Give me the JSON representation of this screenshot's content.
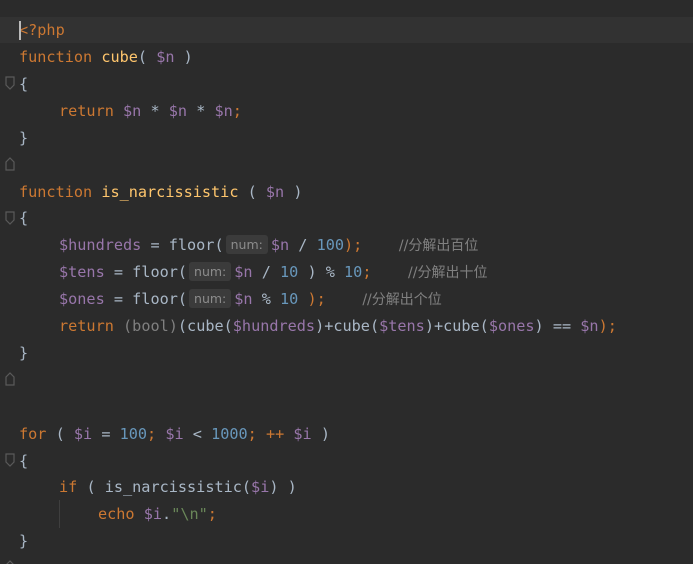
{
  "editor": {
    "theme_colors": {
      "background": "#2b2b2b",
      "keyword": "#cc7832",
      "function": "#ffc66d",
      "variable": "#9876aa",
      "number": "#6897bb",
      "string": "#6a8759",
      "comment": "#808080",
      "text": "#a9b7c6"
    },
    "hint_label": "num:",
    "lines": {
      "l1": {
        "php_open": "<?php"
      },
      "l2": {
        "kw": "function",
        "name": "cube",
        "open": "( ",
        "param": "$n",
        "close": " )"
      },
      "l3": {
        "brace": "{"
      },
      "l4": {
        "kw": "return",
        "v1": "$n",
        "op1": " * ",
        "v2": "$n",
        "op2": " * ",
        "v3": "$n",
        "end": ";"
      },
      "l5": {
        "brace": "}"
      },
      "l6": {
        "kw": "function",
        "name": "is_narcissistic",
        "open": " ( ",
        "param": "$n",
        "close": " )"
      },
      "l7": {
        "brace": "{"
      },
      "l8": {
        "var": "$hundreds",
        "eq": " = ",
        "call": "floor(",
        "arg": "$n",
        "op": " / ",
        "num": "100",
        "close": ");",
        "comment": "//分解出百位"
      },
      "l9": {
        "var": "$tens",
        "eq": " = ",
        "call": "floor(",
        "arg": "$n",
        "op": " / ",
        "num": "10",
        "close": " ) % ",
        "num2": "10",
        "end": ";",
        "comment": "//分解出十位"
      },
      "l10": {
        "var": "$ones",
        "eq": " = ",
        "call": "floor(",
        "arg": "$n",
        "op": " % ",
        "num": "10",
        "close": " );",
        "comment": "//分解出个位"
      },
      "l11": {
        "kw": "return",
        "cast": "(bool)",
        "p1": "(cube(",
        "v1": "$hundreds",
        "p2": ")+cube(",
        "v2": "$tens",
        "p3": ")+cube(",
        "v3": "$ones",
        "p4": ") == ",
        "v4": "$n",
        "end": ");"
      },
      "l12": {
        "brace": "}"
      },
      "l13": {
        "kw": "for",
        "p1": " ( ",
        "v1": "$i",
        "eq": " = ",
        "n1": "100",
        "semi1": "; ",
        "v2": "$i",
        "lt": " < ",
        "n2": "1000",
        "semi2": "; ++ ",
        "v3": "$i",
        "close": " )"
      },
      "l14": {
        "brace": "{"
      },
      "l15": {
        "kw": "if",
        "p1": " ( ",
        "call": "is_narcissistic(",
        "v1": "$i",
        "close": ") )"
      },
      "l16": {
        "kw": "echo",
        "sp": " ",
        "v1": "$i",
        "dot": ".",
        "str": "\"\\n\"",
        "end": ";"
      },
      "l17": {
        "brace": "}"
      }
    }
  }
}
